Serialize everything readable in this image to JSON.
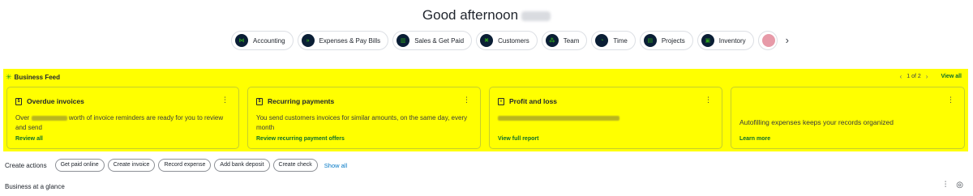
{
  "greeting": {
    "text": "Good afternoon"
  },
  "apps": [
    {
      "label": "Accounting",
      "icon": "accounting-icon",
      "glyph": "⋈"
    },
    {
      "label": "Expenses & Pay Bills",
      "icon": "expenses-icon",
      "glyph": "»"
    },
    {
      "label": "Sales & Get Paid",
      "icon": "sales-icon",
      "glyph": "▥"
    },
    {
      "label": "Customers",
      "icon": "customers-icon",
      "glyph": "✖"
    },
    {
      "label": "Team",
      "icon": "team-icon",
      "glyph": "⁂"
    },
    {
      "label": "Time",
      "icon": "time-icon",
      "glyph": "◔"
    },
    {
      "label": "Projects",
      "icon": "projects-icon",
      "glyph": "▤"
    },
    {
      "label": "Inventory",
      "icon": "inventory-icon",
      "glyph": "▣"
    }
  ],
  "feed": {
    "title": "Business Feed",
    "pager": "1 of 2",
    "view_all": "View all",
    "cards": [
      {
        "title": "Overdue invoices",
        "body_start": "Over",
        "body_end": "worth of invoice reminders are ready for you to review and send",
        "link": "Review all"
      },
      {
        "title": "Recurring payments",
        "body": "You send customers invoices for similar amounts, on the same day, every month",
        "link": "Review recurring payment offers"
      },
      {
        "title": "Profit and loss",
        "link": "View full report"
      },
      {
        "body": "Autofilling expenses keeps your records organized",
        "link": "Learn more"
      }
    ]
  },
  "create_actions": {
    "label": "Create actions",
    "chips": [
      "Get paid online",
      "Create invoice",
      "Record expense",
      "Add bank deposit",
      "Create check"
    ],
    "show_all": "Show all"
  },
  "glance": {
    "title": "Business at a glance"
  },
  "colors": {
    "highlight": "#ffff00",
    "brand_green": "#2ca01c",
    "link_green": "#0d6e2a",
    "link_blue": "#0077c5"
  }
}
